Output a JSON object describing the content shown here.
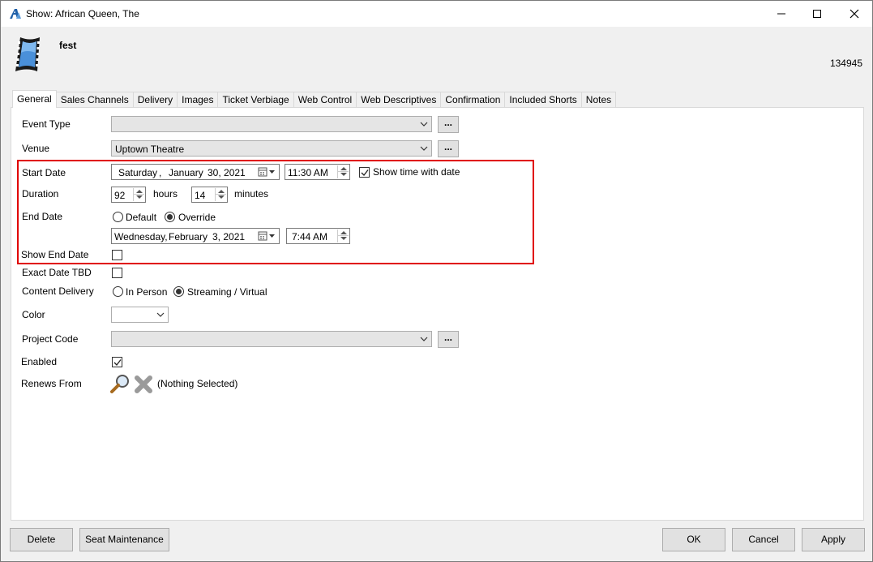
{
  "window": {
    "title": "Show: African Queen, The",
    "controls": [
      "minimize-icon",
      "maximize-icon",
      "close-icon"
    ]
  },
  "header": {
    "name": "fest",
    "id": "134945",
    "icon": "film-strip-icon"
  },
  "tabs": [
    {
      "label": "General",
      "active": true
    },
    {
      "label": "Sales Channels"
    },
    {
      "label": "Delivery"
    },
    {
      "label": "Images"
    },
    {
      "label": "Ticket Verbiage"
    },
    {
      "label": "Web Control"
    },
    {
      "label": "Web Descriptives"
    },
    {
      "label": "Confirmation"
    },
    {
      "label": "Included Shorts"
    },
    {
      "label": "Notes"
    }
  ],
  "form": {
    "event_type": {
      "label": "Event Type",
      "value": "",
      "button": "..."
    },
    "venue": {
      "label": "Venue",
      "value": "Uptown Theatre",
      "button": "..."
    },
    "start_date": {
      "label": "Start Date",
      "weekday": "Saturday",
      "sep": ",",
      "month": "January",
      "day_year": "30, 2021",
      "time": "11:30 AM",
      "show_time_label": "Show time with date",
      "show_time_checked": true
    },
    "duration": {
      "label": "Duration",
      "hours": "92",
      "hours_label": "hours",
      "minutes": "14",
      "minutes_label": "minutes"
    },
    "end_date": {
      "label": "End Date",
      "option_default": "Default",
      "option_override": "Override",
      "selected": "Override",
      "weekday": "Wednesday,",
      "month": "February",
      "day_year": "3, 2021",
      "time": "7:44 AM"
    },
    "show_end_date": {
      "label": "Show End Date",
      "checked": false
    },
    "exact_date_tbd": {
      "label": "Exact Date TBD",
      "checked": false
    },
    "content_delivery": {
      "label": "Content Delivery",
      "option_in_person": "In Person",
      "option_streaming": "Streaming / Virtual",
      "selected": "Streaming / Virtual"
    },
    "color": {
      "label": "Color",
      "value": ""
    },
    "project_code": {
      "label": "Project Code",
      "value": "",
      "button": "..."
    },
    "enabled": {
      "label": "Enabled",
      "checked": true
    },
    "renews_from": {
      "label": "Renews From",
      "value": "(Nothing Selected)"
    }
  },
  "buttons": {
    "delete": "Delete",
    "seat_maintenance": "Seat Maintenance",
    "ok": "OK",
    "cancel": "Cancel",
    "apply": "Apply"
  },
  "colors": {
    "highlight": "#e00000",
    "title_logo": "#1f5fa8"
  }
}
